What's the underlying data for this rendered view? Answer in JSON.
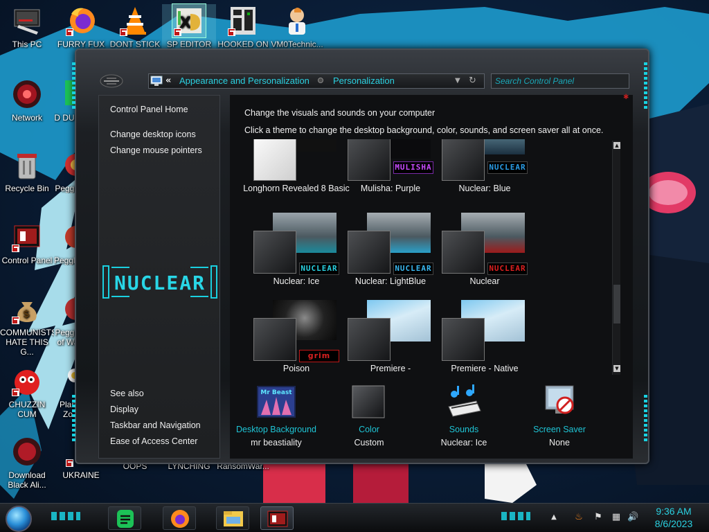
{
  "desktop": {
    "icons": [
      {
        "id": "this-pc",
        "label": "This PC"
      },
      {
        "id": "furry-fux",
        "label": "FURRY FUX"
      },
      {
        "id": "dont-stick",
        "label": "DONT STICK"
      },
      {
        "id": "sp-editor",
        "label": "SP EDITOR"
      },
      {
        "id": "hooked-on",
        "label": "HOOKED ON"
      },
      {
        "id": "vm0techic",
        "label": "VM0Technic..."
      },
      {
        "id": "network",
        "label": "Network"
      },
      {
        "id": "dumb",
        "label": "D DUM"
      },
      {
        "id": "recycle-bin",
        "label": "Recycle Bin"
      },
      {
        "id": "peggle",
        "label": "Peggle"
      },
      {
        "id": "control-panel",
        "label": "Control Panel"
      },
      {
        "id": "peggle-de",
        "label": "Peggle De"
      },
      {
        "id": "communists",
        "label": "COMMUNISTS HATE THIS G..."
      },
      {
        "id": "peggle-wars",
        "label": "Peggle of Wa"
      },
      {
        "id": "chuzzin",
        "label": "CHUZZIN CUM"
      },
      {
        "id": "plant-zo",
        "label": "Plan Zo"
      },
      {
        "id": "download-black",
        "label": "Download Black Ali..."
      },
      {
        "id": "ukraine",
        "label": "UKRAINE"
      },
      {
        "id": "oops",
        "label": "OOPS"
      },
      {
        "id": "lynching",
        "label": "LYNCHING"
      },
      {
        "id": "ransomwar",
        "label": "RansomWar..."
      }
    ]
  },
  "window": {
    "breadcrumb_back": "«",
    "breadcrumb": [
      "Appearance and Personalization",
      "Personalization"
    ],
    "search_placeholder": "Search Control Panel",
    "left_nav": {
      "links": [
        "Control Panel Home",
        "Change desktop icons",
        "Change mouse pointers"
      ],
      "logo_text": "NUCLEAR",
      "see_also_heading": "See also",
      "see_also": [
        "Display",
        "Taskbar and Navigation",
        "Ease of Access Center"
      ]
    },
    "main": {
      "title": "Change the visuals and sounds on your computer",
      "subtitle": "Click a theme to change the desktop background, color, sounds, and screen saver all at once.",
      "themes": [
        {
          "label": "Longhorn Revealed 8 Basic",
          "badge": ""
        },
        {
          "label": "Mulisha: Purple",
          "badge": "MULISHA"
        },
        {
          "label": "Nuclear: Blue",
          "badge": "NUCLEAR"
        },
        {
          "label": "Nuclear: Ice",
          "badge": "NUCLEAR"
        },
        {
          "label": "Nuclear: LightBlue",
          "badge": "NUCLEAR"
        },
        {
          "label": "Nuclear",
          "badge": "NUCLEAR"
        },
        {
          "label": "Poison",
          "badge": "grim"
        },
        {
          "label": "Premiere -",
          "badge": ""
        },
        {
          "label": "Premiere - Native",
          "badge": ""
        }
      ],
      "settings": [
        {
          "title": "Desktop Background",
          "value": "mr beastiality",
          "icon": "desktop-background-icon",
          "thumb_text": "Mr Beast"
        },
        {
          "title": "Color",
          "value": "Custom",
          "icon": "color-icon"
        },
        {
          "title": "Sounds",
          "value": "Nuclear: Ice",
          "icon": "sounds-icon"
        },
        {
          "title": "Screen Saver",
          "value": "None",
          "icon": "screen-saver-icon"
        }
      ]
    }
  },
  "taskbar": {
    "time": "9:36 AM",
    "date": "8/6/2023",
    "colors": {
      "accent": "#2ad0e0"
    }
  }
}
